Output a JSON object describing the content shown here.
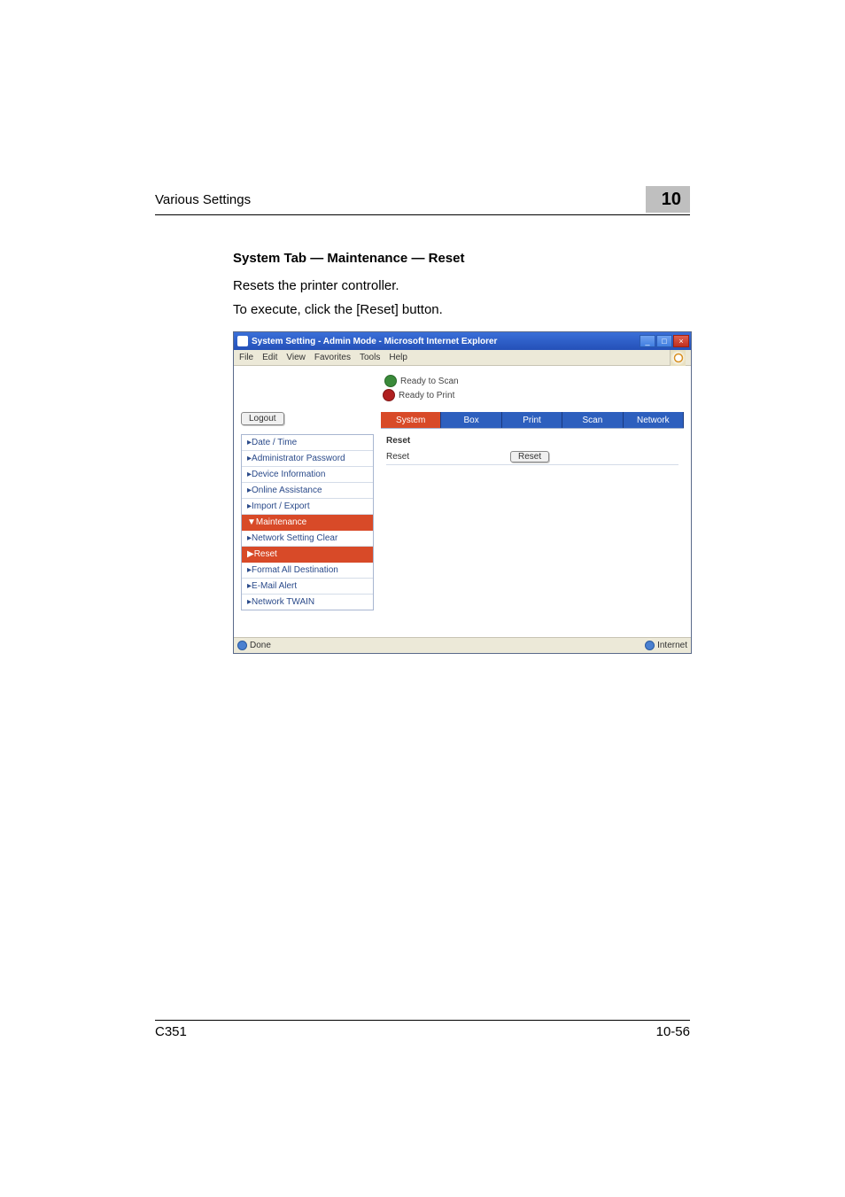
{
  "header": {
    "section": "Various Settings",
    "chapter": "10"
  },
  "content": {
    "heading": "System Tab — Maintenance — Reset",
    "line1": "Resets the printer controller.",
    "line2": "To execute, click the [Reset] button."
  },
  "screenshot": {
    "title": "System Setting - Admin Mode - Microsoft Internet Explorer",
    "menus": {
      "file": "File",
      "edit": "Edit",
      "view": "View",
      "favorites": "Favorites",
      "tools": "Tools",
      "help": "Help"
    },
    "status": {
      "scan": "Ready to Scan",
      "print": "Ready to Print"
    },
    "logout": "Logout",
    "sidemenu": {
      "date": "▸Date / Time",
      "admin": "▸Administrator Password",
      "devinfo": "▸Device Information",
      "online": "▸Online Assistance",
      "impexp": "▸Import / Export",
      "maint": "▼Maintenance",
      "netclear": "▸Network Setting Clear",
      "reset": "▶Reset",
      "format": "▸Format All Destination",
      "email": "▸E-Mail Alert",
      "twain": "▸Network TWAIN"
    },
    "tabs": {
      "system": "System",
      "box": "Box",
      "print": "Print",
      "scan": "Scan",
      "network": "Network"
    },
    "panel": {
      "title": "Reset",
      "row_label": "Reset",
      "button": "Reset"
    },
    "status_left": "Done",
    "status_right": "Internet"
  },
  "footer": {
    "model": "C351",
    "page": "10-56"
  }
}
